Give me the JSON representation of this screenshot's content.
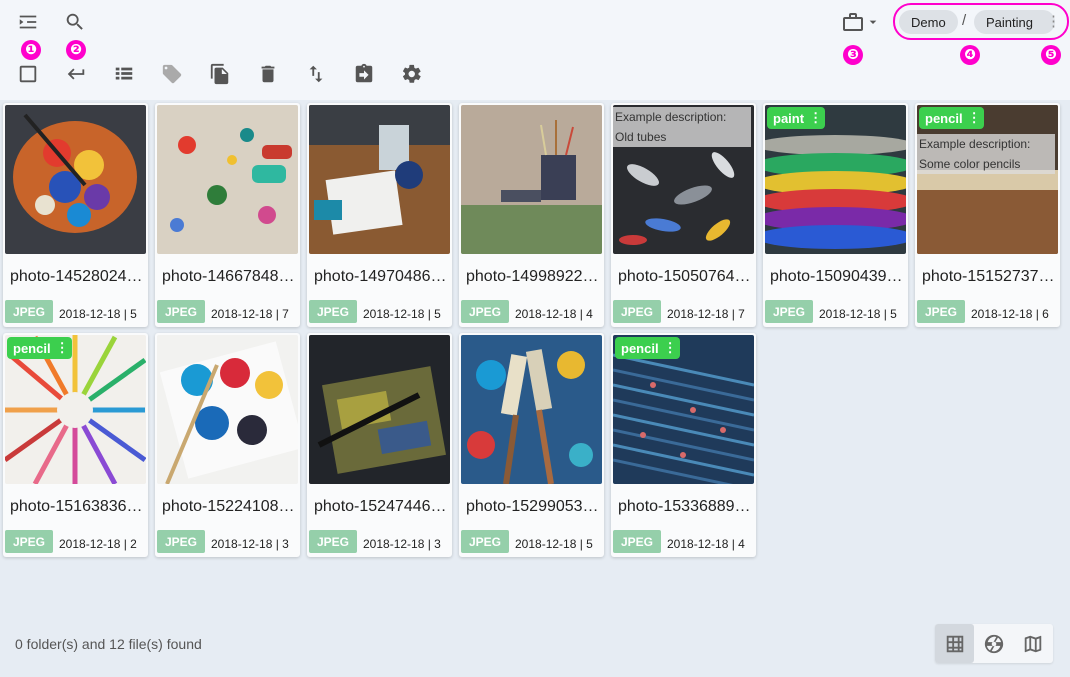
{
  "toolbar": {
    "icons": [
      "expand-menu-icon",
      "search-icon",
      "checkbox-icon",
      "return-icon",
      "list-view-icon",
      "tag-icon",
      "copy-icon",
      "delete-icon",
      "sort-icon",
      "move-icon",
      "settings-icon",
      "briefcase-icon"
    ]
  },
  "markers": [
    "❶",
    "❷",
    "❸",
    "❹",
    "❺"
  ],
  "breadcrumb": {
    "items": [
      "Demo",
      "Painting"
    ],
    "separator": "/",
    "more": "⋮"
  },
  "files": [
    {
      "name": "photo-14528024…",
      "type": "JPEG",
      "meta": "2018-12-18 | 5",
      "tag": "",
      "desc": []
    },
    {
      "name": "photo-14667848…",
      "type": "JPEG",
      "meta": "2018-12-18 | 7",
      "tag": "",
      "desc": []
    },
    {
      "name": "photo-14970486…",
      "type": "JPEG",
      "meta": "2018-12-18 | 5",
      "tag": "",
      "desc": []
    },
    {
      "name": "photo-14998922…",
      "type": "JPEG",
      "meta": "2018-12-18 | 4",
      "tag": "",
      "desc": []
    },
    {
      "name": "photo-15050764…",
      "type": "JPEG",
      "meta": "2018-12-18 | 7",
      "tag": "",
      "desc": [
        "Example description:",
        "Old tubes"
      ]
    },
    {
      "name": "photo-15090439…",
      "type": "JPEG",
      "meta": "2018-12-18 | 5",
      "tag": "paint",
      "desc": []
    },
    {
      "name": "photo-15152737…",
      "type": "JPEG",
      "meta": "2018-12-18 | 6",
      "tag": "pencil",
      "desc": [
        "Example description:",
        "Some color pencils"
      ]
    },
    {
      "name": "photo-15163836…",
      "type": "JPEG",
      "meta": "2018-12-18 | 2",
      "tag": "pencil",
      "desc": []
    },
    {
      "name": "photo-15224108…",
      "type": "JPEG",
      "meta": "2018-12-18 | 3",
      "tag": "",
      "desc": []
    },
    {
      "name": "photo-15247446…",
      "type": "JPEG",
      "meta": "2018-12-18 | 3",
      "tag": "",
      "desc": []
    },
    {
      "name": "photo-15299053…",
      "type": "JPEG",
      "meta": "2018-12-18 | 5",
      "tag": "",
      "desc": []
    },
    {
      "name": "photo-15336889…",
      "type": "JPEG",
      "meta": "2018-12-18 | 4",
      "tag": "pencil",
      "desc": []
    }
  ],
  "footer": {
    "status": "0 folder(s) and 12 file(s) found"
  },
  "view_modes": {
    "icons": [
      "grid-view-icon",
      "aperture-view-icon",
      "map-view-icon"
    ],
    "active": "grid-view-icon"
  },
  "colors": {
    "accent_marker": "#ff00cc",
    "tag_green": "#3ccf4e",
    "jpeg_badge": "#95cfaa",
    "background": "#e6ecf3"
  }
}
